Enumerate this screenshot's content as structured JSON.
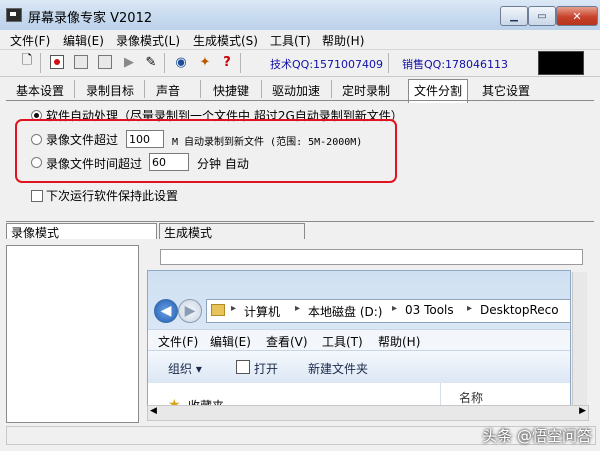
{
  "window": {
    "title": "屏幕录像专家 V2012"
  },
  "menu": [
    "文件(F)",
    "编辑(E)",
    "录像模式(L)",
    "生成模式(S)",
    "工具(T)",
    "帮助(H)"
  ],
  "toolbar": {
    "tech_qq": "技术QQ:1571007409",
    "sales_qq": "销售QQ:178046113"
  },
  "tabs": [
    "基本设置",
    "录制目标",
    "声音",
    "快捷键",
    "驱动加速",
    "定时录制",
    "文件分割",
    "其它设置"
  ],
  "options": {
    "auto": "软件自动处理（尽量录制到一个文件中 超过2G自动录制到新文件）",
    "size_prefix": "录像文件超过",
    "size_value": "100",
    "size_suffix": "M 自动录制到新文件 (范围: 5M-2000M)",
    "time_prefix": "录像文件时间超过",
    "time_value": "60",
    "time_suffix": "分钟 自动",
    "keep_setting": "下次运行软件保持此设置"
  },
  "panels": {
    "record_tab": "录像模式",
    "gen_tab": "生成模式"
  },
  "explorer": {
    "path": [
      "计算机",
      "本地磁盘 (D:)",
      "03 Tools",
      "DesktopReco"
    ],
    "menu": [
      "文件(F)",
      "编辑(E)",
      "查看(V)",
      "工具(T)",
      "帮助(H)"
    ],
    "organize": "组织 ▾",
    "open": "打开",
    "new_folder": "新建文件夹",
    "col_name": "名称",
    "favorites": "收藏夹"
  },
  "watermark": "头条 @悟空问答"
}
